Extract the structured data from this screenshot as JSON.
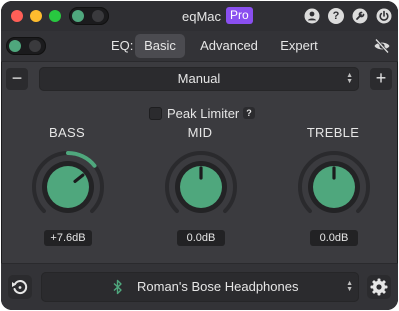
{
  "window": {
    "app_title": "eqMac",
    "badge": "Pro"
  },
  "titlebar": {
    "traffic_lights": [
      "red",
      "yellow",
      "green"
    ],
    "power_toggle": {
      "state": "on",
      "on_color": "#4fa77d"
    },
    "right_icons": [
      "account-icon",
      "help-icon",
      "settings-icon",
      "power-icon"
    ],
    "help_glyph": "?"
  },
  "toolbar": {
    "eq_toggle": {
      "state": "on"
    },
    "eq_label": "EQ:",
    "tabs": [
      {
        "label": "Basic",
        "active": true
      },
      {
        "label": "Advanced",
        "active": false
      },
      {
        "label": "Expert",
        "active": false
      }
    ],
    "hide_icon": "eye-slash-icon"
  },
  "preset": {
    "remove_label": "−",
    "selected": "Manual",
    "add_label": "+"
  },
  "limiter": {
    "label": "Peak Limiter",
    "checked": false,
    "help": "?"
  },
  "bands": [
    {
      "name": "BASS",
      "value": "+7.6dB",
      "level": 0.69
    },
    {
      "name": "MID",
      "value": "0.0dB",
      "level": 0.5
    },
    {
      "name": "TREBLE",
      "value": "0.0dB",
      "level": 0.5
    }
  ],
  "bottom": {
    "reset_icon": "reset-icon",
    "output_icon": "bluetooth-icon",
    "output_device": "Roman's Bose Headphones",
    "settings_icon": "gear-icon"
  },
  "colors": {
    "accent": "#4fa77d",
    "window_bg": "#3b3b3f",
    "badge_bg": "#8a4ff0"
  }
}
